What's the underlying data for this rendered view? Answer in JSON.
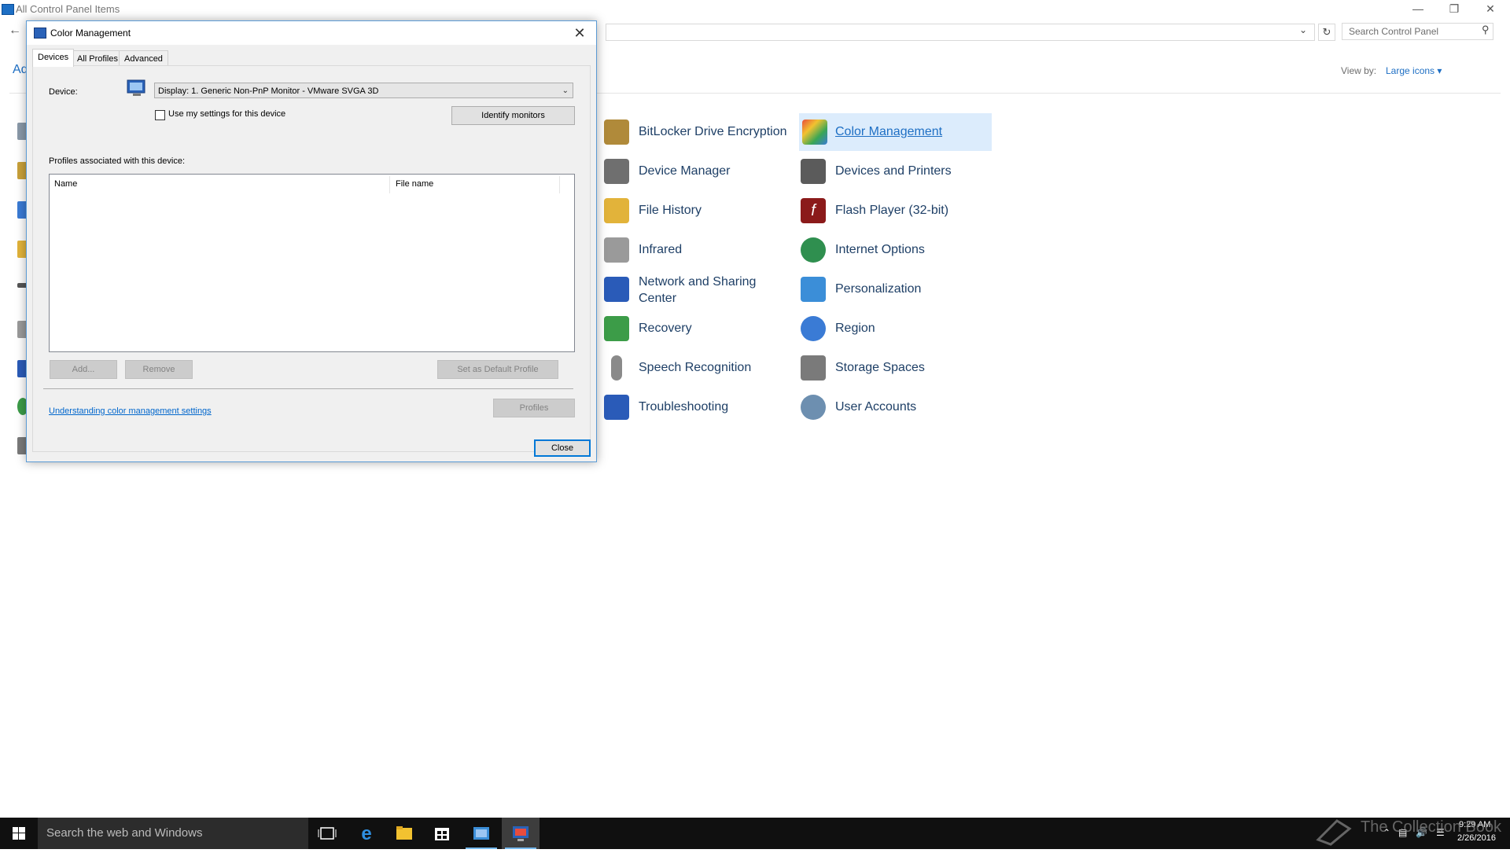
{
  "control_panel": {
    "title": "All Control Panel Items",
    "search_placeholder": "Search Control Panel",
    "adjust_partial": "Ad",
    "view_by_label": "View by:",
    "view_by_value": "Large icons ▾",
    "items": [
      {
        "label": "BitLocker Drive Encryption",
        "icon": "bitlocker-key-icon",
        "color": "#b08a3a"
      },
      {
        "label": "Color Management",
        "icon": "color-management-icon",
        "color": "#3a7bd5"
      },
      {
        "label": "Device Manager",
        "icon": "device-manager-icon",
        "color": "#6f6f6f"
      },
      {
        "label": "Devices and Printers",
        "icon": "printer-icon",
        "color": "#5b5b5b"
      },
      {
        "label": "File History",
        "icon": "file-history-icon",
        "color": "#e2b33a"
      },
      {
        "label": "Flash Player (32-bit)",
        "icon": "flash-player-icon",
        "color": "#8b1a1a"
      },
      {
        "label": "Infrared",
        "icon": "infrared-icon",
        "color": "#9a9a9a"
      },
      {
        "label": "Internet Options",
        "icon": "internet-options-icon",
        "color": "#2f8f4f"
      },
      {
        "label": "Network and Sharing Center",
        "icon": "network-icon",
        "color": "#2a5bb8"
      },
      {
        "label": "Personalization",
        "icon": "personalization-icon",
        "color": "#3b8ed8"
      },
      {
        "label": "Recovery",
        "icon": "recovery-icon",
        "color": "#3c9c48"
      },
      {
        "label": "Region",
        "icon": "region-globe-icon",
        "color": "#3a7bd5"
      },
      {
        "label": "Speech Recognition",
        "icon": "microphone-icon",
        "color": "#8a8a8a"
      },
      {
        "label": "Storage Spaces",
        "icon": "storage-spaces-icon",
        "color": "#7a7a7a"
      },
      {
        "label": "Troubleshooting",
        "icon": "troubleshooting-icon",
        "color": "#2a5bb8"
      },
      {
        "label": "User Accounts",
        "icon": "user-accounts-icon",
        "color": "#6d8fb0"
      }
    ]
  },
  "dialog": {
    "title": "Color Management",
    "tabs": [
      "Devices",
      "All Profiles",
      "Advanced"
    ],
    "device_label": "Device:",
    "device_value": "Display: 1. Generic Non-PnP Monitor - VMware SVGA 3D",
    "use_my_settings": "Use my settings for this device",
    "use_my_settings_checked": false,
    "identify_button": "Identify monitors",
    "profiles_label": "Profiles associated with this device:",
    "columns": [
      "Name",
      "File name"
    ],
    "add_button": "Add...",
    "remove_button": "Remove",
    "default_button": "Set as Default Profile",
    "help_link": "Understanding color management settings",
    "profiles_button": "Profiles",
    "close_button": "Close"
  },
  "taskbar": {
    "search_text": "Search the web and Windows",
    "watermark": "The Collection Book",
    "time": "9:29 AM",
    "date": "2/26/2016",
    "accent": "#76b9ed"
  }
}
